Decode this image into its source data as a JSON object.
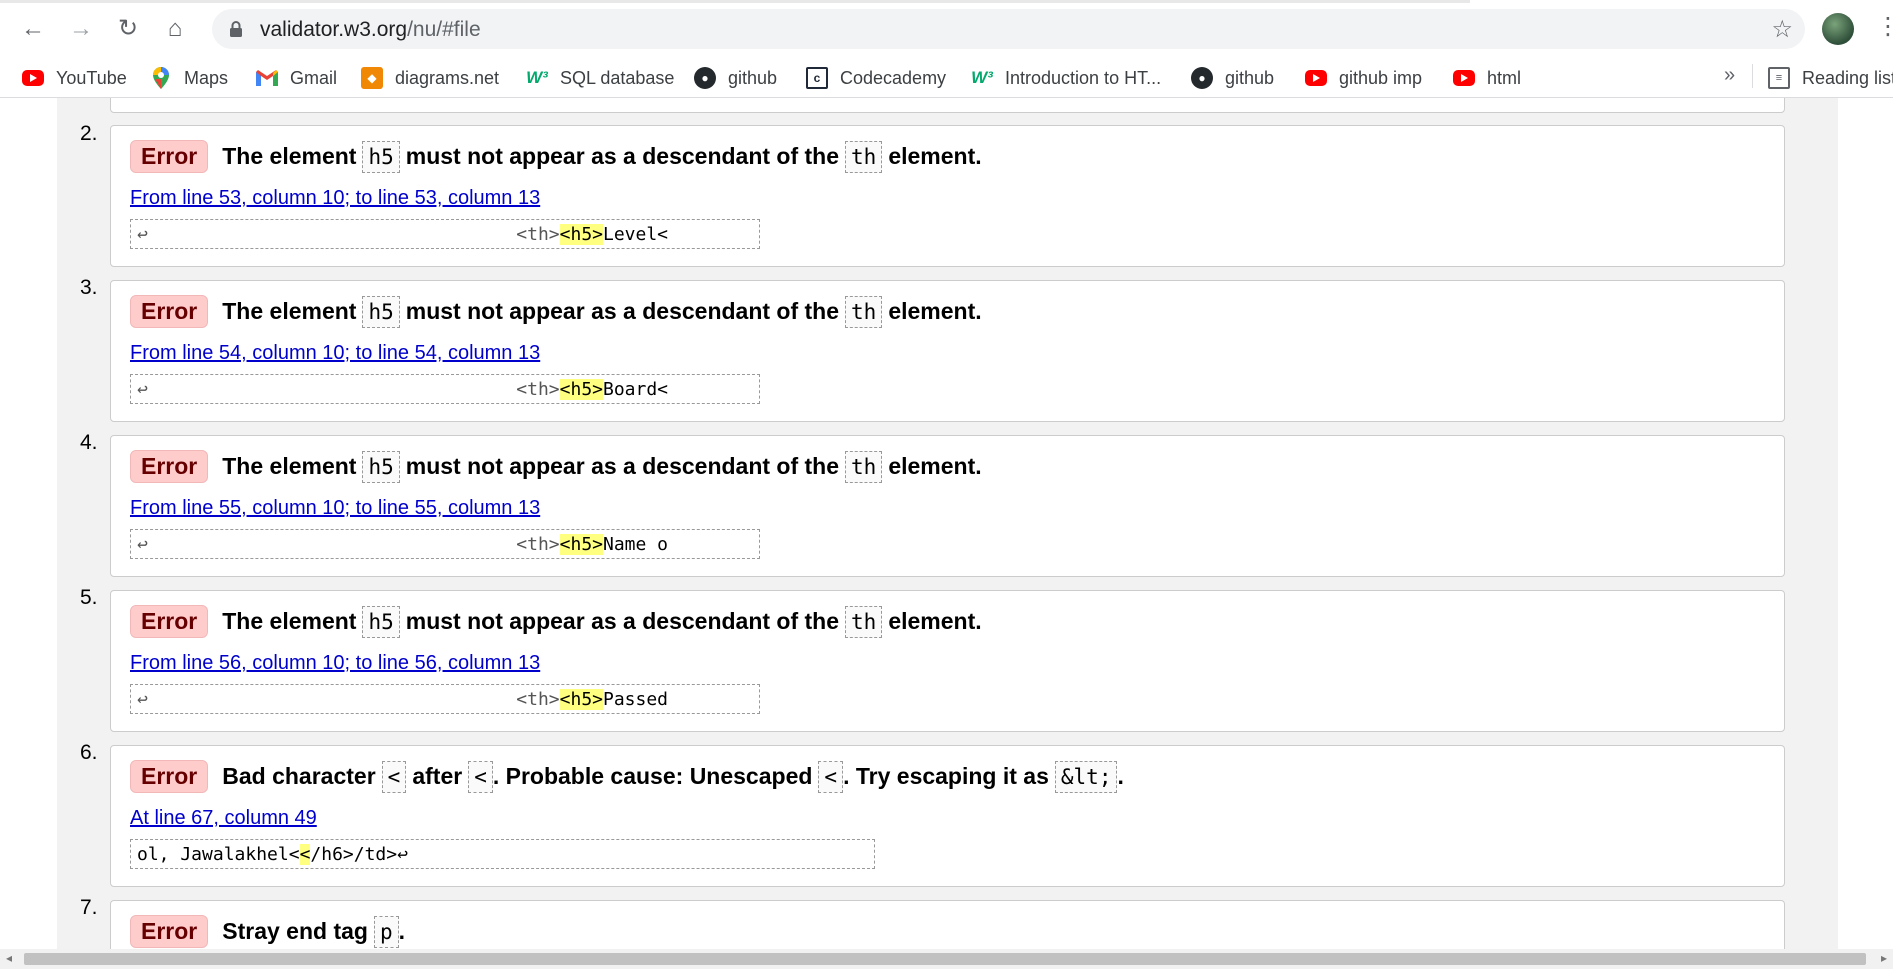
{
  "browser": {
    "url_host": "validator.w3.org",
    "url_path": "/nu/#file",
    "back_icon": "←",
    "forward_icon": "→",
    "reload_icon": "↻",
    "home_icon": "⌂",
    "star_icon": "☆",
    "menu_icon": "⋮"
  },
  "bookmarks": [
    {
      "label": "YouTube",
      "icon": "youtube-icon"
    },
    {
      "label": "Maps",
      "icon": "maps-icon"
    },
    {
      "label": "Gmail",
      "icon": "gmail-icon"
    },
    {
      "label": "diagrams.net",
      "icon": "diagrams-icon"
    },
    {
      "label": "SQL database",
      "icon": "w3schools-icon"
    },
    {
      "label": "github",
      "icon": "github-icon"
    },
    {
      "label": "Codecademy",
      "icon": "codecademy-icon"
    },
    {
      "label": "Introduction to HT...",
      "icon": "w3schools-icon"
    },
    {
      "label": "github",
      "icon": "github-icon"
    },
    {
      "label": "github imp",
      "icon": "youtube-icon"
    },
    {
      "label": "html",
      "icon": "youtube-icon"
    }
  ],
  "bookmarks_more": "»",
  "reading_list": "Reading list",
  "messages": [
    {
      "number": "2.",
      "type": "Error",
      "text_a": "The element",
      "code_a": "h5",
      "text_b": "must not appear as a descendant of the",
      "code_b": "th",
      "text_c": "element.",
      "location": "From line 53, column 10; to line 53, column 13",
      "extract_pre": "↩                                  <th>",
      "extract_hl": "<h5>",
      "extract_post": "Level<"
    },
    {
      "number": "3.",
      "type": "Error",
      "text_a": "The element",
      "code_a": "h5",
      "text_b": "must not appear as a descendant of the",
      "code_b": "th",
      "text_c": "element.",
      "location": "From line 54, column 10; to line 54, column 13",
      "extract_pre": "↩                                  <th>",
      "extract_hl": "<h5>",
      "extract_post": "Board<"
    },
    {
      "number": "4.",
      "type": "Error",
      "text_a": "The element",
      "code_a": "h5",
      "text_b": "must not appear as a descendant of the",
      "code_b": "th",
      "text_c": "element.",
      "location": "From line 55, column 10; to line 55, column 13",
      "extract_pre": "↩                                  <th>",
      "extract_hl": "<h5>",
      "extract_post": "Name o"
    },
    {
      "number": "5.",
      "type": "Error",
      "text_a": "The element",
      "code_a": "h5",
      "text_b": "must not appear as a descendant of the",
      "code_b": "th",
      "text_c": "element.",
      "location": "From line 56, column 10; to line 56, column 13",
      "extract_pre": "↩                                  <th>",
      "extract_hl": "<h5>",
      "extract_post": "Passed"
    },
    {
      "number": "6.",
      "type": "Error",
      "text_a": "Bad character",
      "code_a": "<",
      "text_b": "after",
      "code_b": "<",
      "text_c": ". Probable cause: Unescaped",
      "code_c": "<",
      "text_d": ". Try escaping it as",
      "code_d": "&lt;",
      "text_e": ".",
      "location": "At line 67, column 49",
      "extract_pre": "ol, Jawalakhel<",
      "extract_hl": "<",
      "extract_post": "/h6>/td>↩"
    },
    {
      "number": "7.",
      "type": "Error",
      "text_a": "Stray end tag",
      "code_a": "p",
      "text_b": "."
    }
  ]
}
